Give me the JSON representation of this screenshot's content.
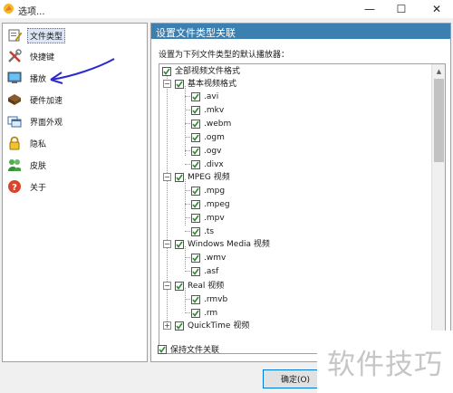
{
  "window": {
    "title": "选项..."
  },
  "sidebar": {
    "items": [
      {
        "label": "文件类型",
        "icon": "file-type-icon",
        "selected": true
      },
      {
        "label": "快捷键",
        "icon": "tools-icon",
        "selected": false
      },
      {
        "label": "播放",
        "icon": "monitor-icon",
        "selected": false
      },
      {
        "label": "硬件加速",
        "icon": "hardware-icon",
        "selected": false
      },
      {
        "label": "界面外观",
        "icon": "window-icon",
        "selected": false
      },
      {
        "label": "隐私",
        "icon": "lock-icon",
        "selected": false
      },
      {
        "label": "皮肤",
        "icon": "skin-icon",
        "selected": false
      },
      {
        "label": "关于",
        "icon": "help-icon",
        "selected": false
      }
    ]
  },
  "panel": {
    "header": "设置文件类型关联",
    "description": "设置为下列文件类型的默认播放器：",
    "tree": {
      "root": "全部视频文件格式",
      "groups": [
        {
          "label": "基本视频格式",
          "items": [
            ".avi",
            ".mkv",
            ".webm",
            ".ogm",
            ".ogv",
            ".divx"
          ]
        },
        {
          "label": "MPEG 视频",
          "items": [
            ".mpg",
            ".mpeg",
            ".mpv",
            ".ts"
          ]
        },
        {
          "label": "Windows Media 视频",
          "items": [
            ".wmv",
            ".asf"
          ]
        },
        {
          "label": "Real 视频",
          "items": [
            ".rmvb",
            ".rm"
          ]
        },
        {
          "label": "QuickTime 视频",
          "items": []
        }
      ]
    },
    "keep_association": "保持文件关联"
  },
  "footer": {
    "ok_label": "确定(O)"
  },
  "watermark": "软件技巧",
  "colors": {
    "header_bg": "#3c7fb1",
    "check": "#2e8b2e",
    "arrow": "#2a2ad0"
  }
}
